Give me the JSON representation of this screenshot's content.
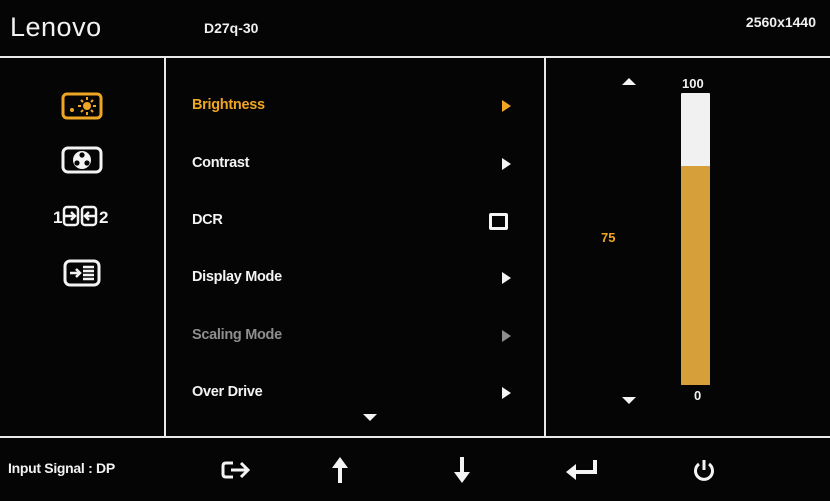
{
  "header": {
    "brand": "Lenovo",
    "model": "D27q-30",
    "resolution": "2560x1440"
  },
  "colors": {
    "accent": "#f0a623",
    "text": "#f4f4f4",
    "disabled": "#8e8e8e",
    "frame": "#e9e9e9",
    "slider_track": "#f1f1f1",
    "slider_fill": "#d79f3a"
  },
  "categories": [
    {
      "icon": "picture-settings-icon",
      "active": true
    },
    {
      "icon": "color-settings-icon",
      "active": false
    },
    {
      "icon": "input-source-icon",
      "active": false
    },
    {
      "icon": "menu-settings-icon",
      "active": false
    }
  ],
  "input_source_icon_labels": [
    "1",
    "2"
  ],
  "menu": {
    "items": [
      {
        "label": "Brightness",
        "state": "active",
        "control": "arrow"
      },
      {
        "label": "Contrast",
        "state": "normal",
        "control": "arrow"
      },
      {
        "label": "DCR",
        "state": "normal",
        "control": "checkbox",
        "checked": false
      },
      {
        "label": "Display Mode",
        "state": "normal",
        "control": "arrow"
      },
      {
        "label": "Scaling Mode",
        "state": "disabled",
        "control": "arrow"
      },
      {
        "label": "Over Drive",
        "state": "normal",
        "control": "arrow"
      }
    ],
    "more_indicator": "chevron-down-icon"
  },
  "slider": {
    "max_label": "100",
    "min_label": "0",
    "value_label": "75",
    "value": 75,
    "max": 100,
    "min": 0
  },
  "footer": {
    "input_signal": "Input Signal : DP",
    "keys": [
      {
        "icon": "exit-icon"
      },
      {
        "icon": "arrow-up-icon"
      },
      {
        "icon": "arrow-down-icon"
      },
      {
        "icon": "enter-icon"
      },
      {
        "icon": "power-icon"
      }
    ]
  }
}
